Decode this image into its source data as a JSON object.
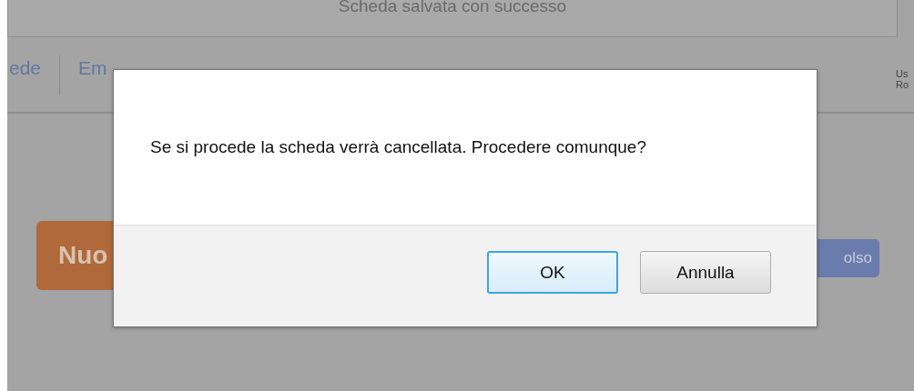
{
  "banner": {
    "text": "Scheda salvata con successo"
  },
  "nav": {
    "items": [
      {
        "label": "ede"
      },
      {
        "label": "Em"
      }
    ],
    "user": [
      "Us",
      "Ro"
    ]
  },
  "actions": [
    {
      "kind": "new",
      "label": "Nuo"
    },
    {
      "kind": "other",
      "label": "olso"
    }
  ],
  "dialog": {
    "message": "Se si procede la scheda verrà cancellata. Procedere comunque?",
    "buttons": [
      {
        "label": "OK",
        "selected": true
      },
      {
        "label": "Annulla",
        "selected": false
      }
    ]
  }
}
